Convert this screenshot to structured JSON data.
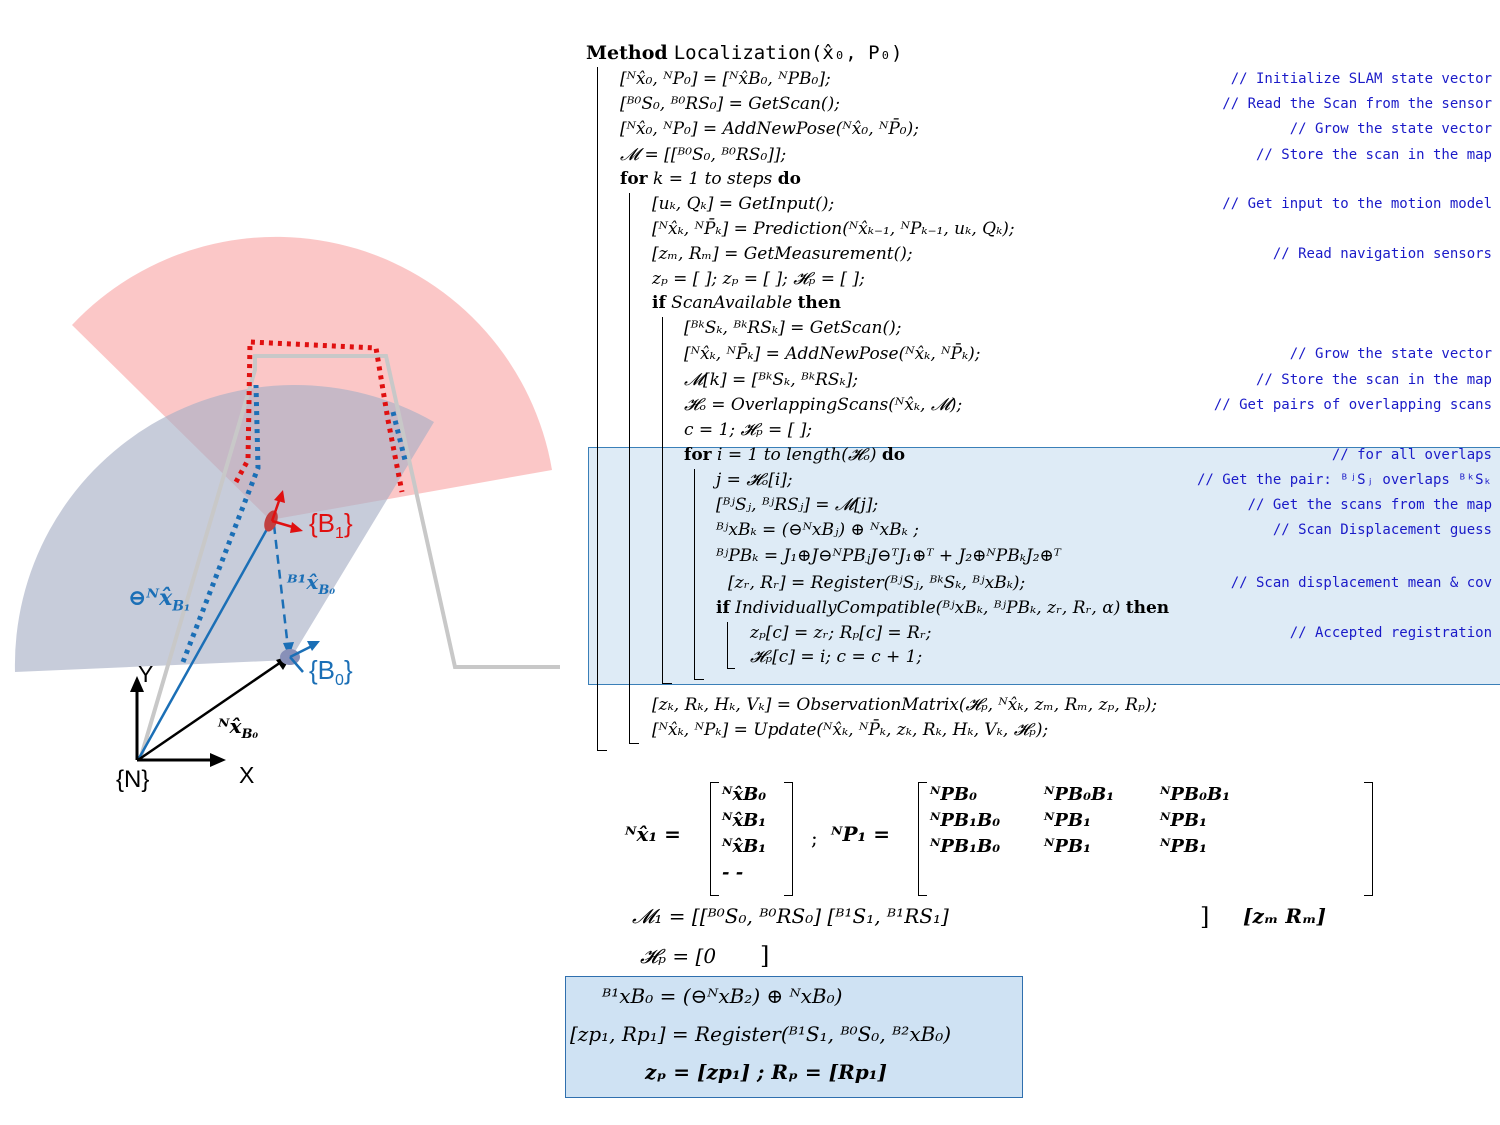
{
  "diagram": {
    "frame_N": "{N}",
    "axis_x": "X",
    "axis_y": "Y",
    "frame_B0": "{B",
    "frame_B0_sub": "0",
    "frame_B1": "{B",
    "frame_B1_sub": "1",
    "vec_N_to_B0": "ᴺx̂",
    "vec_N_to_B0_sub": "B₀",
    "vec_B1_B0": "ᴮ¹x̂",
    "vec_B1_B0_sub": "B₀",
    "vec_inv": "⊖ᴺx̂",
    "vec_inv_sub": "B₁",
    "colors": {
      "red_fov": "#f8b0b0",
      "blue_fov": "#b9c0d0",
      "red": "#e01010",
      "blue": "#1b6fb6"
    }
  },
  "algorithm": {
    "header_kw": "Method",
    "header_name": "Localization(x̂₀, P₀)",
    "lines": [
      {
        "text": "[ᴺx̂₀, ᴺP₀] = [ᴺx̂B₀, ᴺPB₀];",
        "comment": "// Initialize SLAM state vector"
      },
      {
        "text": "[ᴮ⁰S₀, ᴮ⁰RS₀] = GetScan();",
        "comment": "// Read the Scan from the sensor"
      },
      {
        "text": "[ᴺx̂₀, ᴺP₀] = AddNewPose(ᴺx̂₀, ᴺP̄₀);",
        "comment": "// Grow the state vector"
      },
      {
        "text": "𝓜 = [[ᴮ⁰S₀, ᴮ⁰RS₀]];",
        "comment": "// Store the scan in the map"
      },
      {
        "kw1": "for",
        "text": " k = 1 to steps ",
        "kw2": "do",
        "comment": ""
      },
      {
        "text": "[uₖ, Qₖ] = GetInput();",
        "comment": "// Get input to the motion model"
      },
      {
        "text": "[ᴺx̂ₖ, ᴺP̄ₖ] = Prediction(ᴺx̂ₖ₋₁, ᴺPₖ₋₁, uₖ, Qₖ);",
        "comment": ""
      },
      {
        "text": "[zₘ, Rₘ] = GetMeasurement();",
        "comment": "// Read navigation sensors"
      },
      {
        "text": "zₚ = [ ]; zₚ = [ ]; 𝓗ₚ = [ ];",
        "comment": ""
      },
      {
        "kw1": "if",
        "text": " ScanAvailable ",
        "kw2": "then",
        "comment": ""
      },
      {
        "text": "[ᴮᵏSₖ, ᴮᵏRSₖ] = GetScan();",
        "comment": ""
      },
      {
        "text": "[ᴺx̂ₖ, ᴺP̄ₖ] = AddNewPose(ᴺx̂ₖ, ᴺP̄ₖ);",
        "comment": "// Grow the state vector"
      },
      {
        "text": "𝓜[k] = [ᴮᵏSₖ, ᴮᵏRSₖ];",
        "comment": "// Store the scan in the map"
      },
      {
        "text": "𝓗ₒ = OverlappingScans(ᴺx̂ₖ, 𝓜);",
        "comment": "// Get pairs of overlapping scans"
      },
      {
        "text": "c = 1; 𝓗ₚ = [ ];",
        "comment": ""
      },
      {
        "kw1": "for",
        "text": " i = 1 to length(𝓗ₒ) ",
        "kw2": "do",
        "comment": "// for all overlaps"
      },
      {
        "text": "j = 𝓗ₒ[i];",
        "comment": "// Get the pair:  ᴮʲSⱼ overlaps ᴮᵏSₖ"
      },
      {
        "text": "[ᴮʲSⱼ, ᴮʲRSⱼ] = 𝓜[j];",
        "comment": "// Get the scans from the map"
      },
      {
        "text": "ᴮʲxBₖ = (⊖ᴺxBⱼ) ⊕ ᴺxBₖ ;",
        "comment": "// Scan Displacement guess"
      },
      {
        "text": "ᴮʲPBₖ = J₁⊕J⊖ᴺPBⱼJ⊖ᵀJ₁⊕ᵀ + J₂⊕ᴺPBₖJ₂⊕ᵀ",
        "comment": ""
      },
      {
        "text": "[zᵣ, Rᵣ] = Register(ᴮʲSⱼ, ᴮᵏSₖ, ᴮʲxBₖ);",
        "comment": "// Scan displacement mean & cov"
      },
      {
        "kw1": "if",
        "text": " IndividuallyCompatible(ᴮʲxBₖ, ᴮʲPBₖ, zᵣ, Rᵣ, α) ",
        "kw2": "then",
        "comment": ""
      },
      {
        "text": "zₚ[c] = zᵣ;  Rₚ[c] = Rᵣ;",
        "comment": "// Accepted registration"
      },
      {
        "text": "𝓗ₚ[c] = i; c = c + 1;",
        "comment": ""
      },
      {
        "text": "[zₖ, Rₖ, Hₖ, Vₖ] = ObservationMatrix(𝓗ₚ, ᴺx̂ₖ, zₘ, Rₘ, zₚ, Rₚ);",
        "comment": ""
      },
      {
        "text": "[ᴺx̂ₖ, ᴺPₖ] = Update(ᴺx̂ₖ, ᴺP̄ₖ, zₖ, Rₖ, Hₖ, Vₖ, 𝓗ₚ);",
        "comment": ""
      }
    ]
  },
  "equations": {
    "x1_lhs": "ᴺx̂₁ =",
    "x1_rows": [
      "ᴺx̂B₀",
      "ᴺx̂B₁",
      "ᴺx̂B₁",
      "- -"
    ],
    "sep": ";",
    "p1_lhs": "ᴺP₁ =",
    "p1_rows": [
      [
        "ᴺPB₀",
        "ᴺPB₀B₁",
        "ᴺPB₀B₁"
      ],
      [
        "ᴺPB₁B₀",
        "ᴺPB₁",
        "ᴺPB₁"
      ],
      [
        "ᴺPB₁B₀",
        "ᴺPB₁",
        "ᴺPB₁"
      ]
    ],
    "m1": "𝓜₁ = [[ᴮ⁰S₀, ᴮ⁰RS₀] [ᴮ¹S₁, ᴮ¹RS₁]",
    "zm_rm": "[zₘ    Rₘ]",
    "hp": "𝓗ₚ = [0",
    "box1": "ᴮ¹xB₀ = (⊖ᴺxB₂) ⊕ ᴺxB₀)",
    "box2": "[zp₁, Rp₁] = Register(ᴮ¹S₁, ᴮ⁰S₀, ᴮ²xB₀)",
    "box3": "zₚ = [zp₁]  ;  Rₚ = [Rp₁]"
  }
}
